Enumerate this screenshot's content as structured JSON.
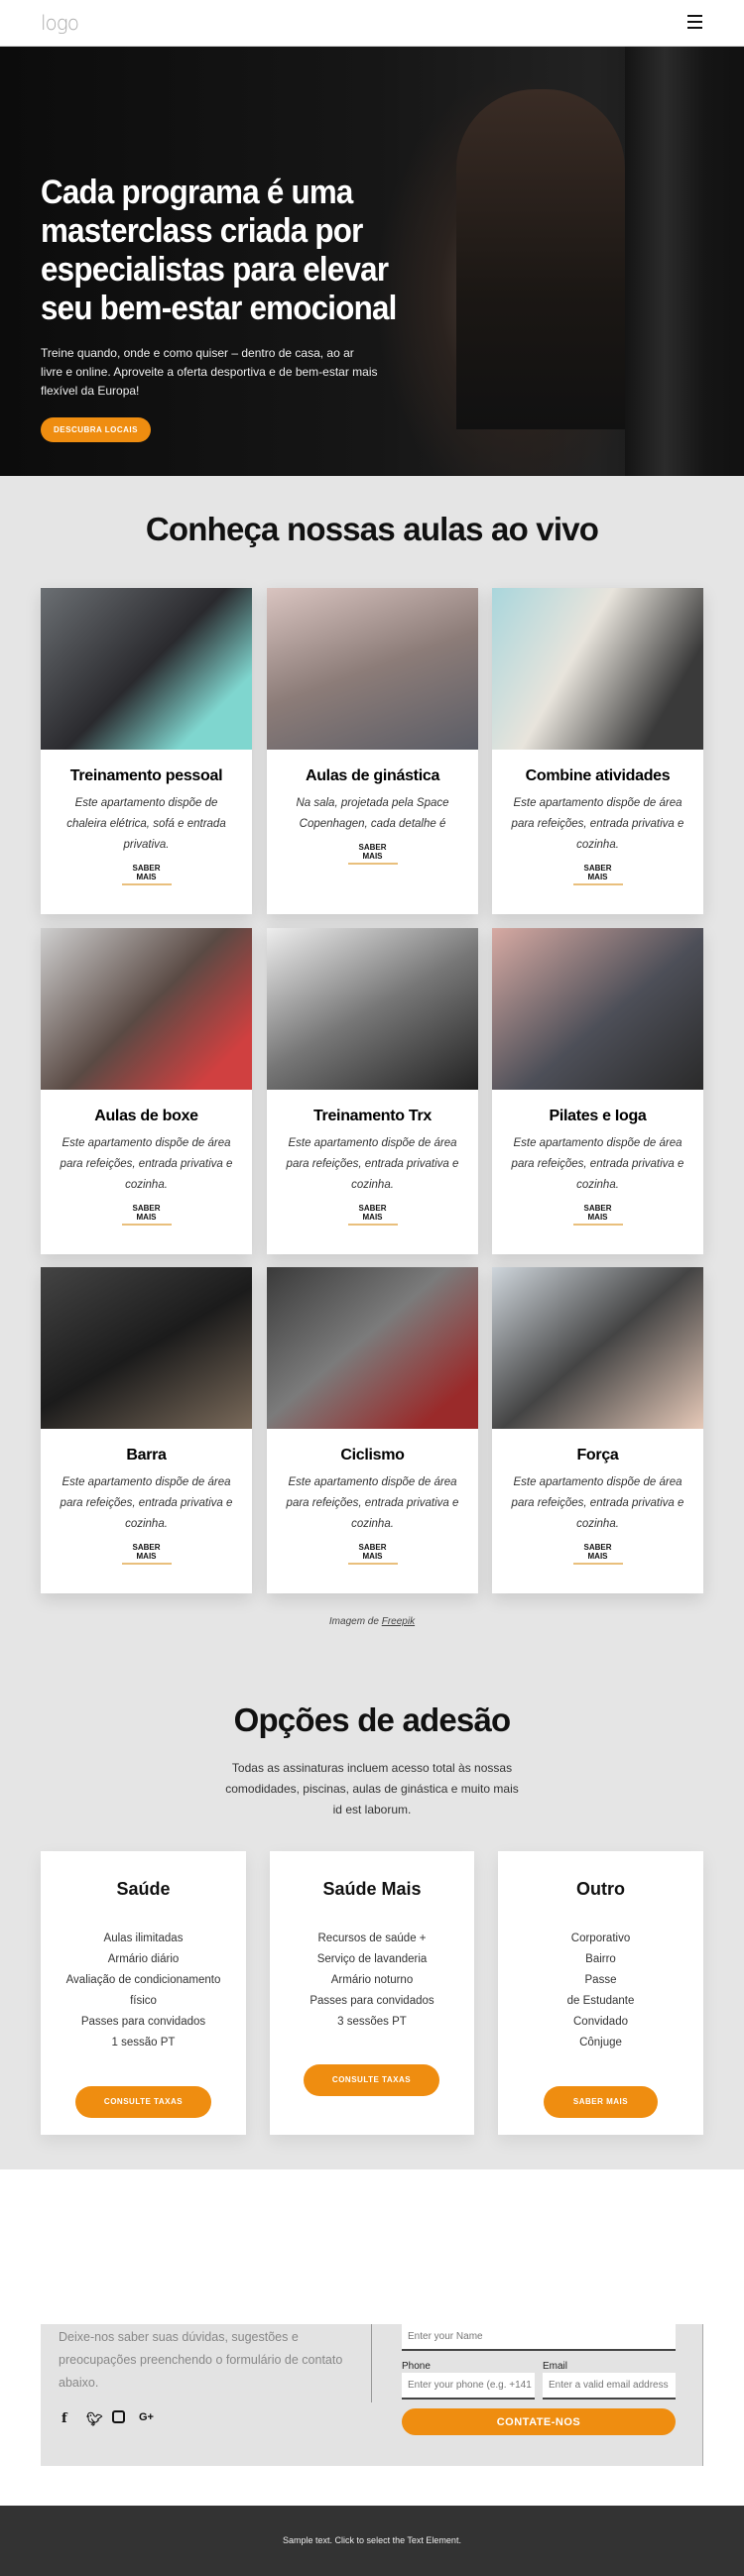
{
  "header": {
    "logo": "logo",
    "menu_icon": "hamburger-icon"
  },
  "hero": {
    "title": "Cada programa é uma masterclass criada por especialistas para elevar seu bem-estar emocional",
    "text": "Treine quando, onde e como quiser – dentro de casa, ao ar livre e online. Aproveite a oferta desportiva e de bem-estar mais flexível da Europa!",
    "button": "DESCUBRA LOCAIS"
  },
  "classes": {
    "title": "Conheça nossas aulas ao vivo",
    "items": [
      {
        "title": "Treinamento pessoal",
        "text": "Este apartamento dispõe de chaleira elétrica, sofá e entrada privativa.",
        "link": "SABER MAIS"
      },
      {
        "title": "Aulas de ginástica",
        "text": "Na sala, projetada pela Space Copenhagen, cada detalhe é",
        "link": "SABER MAIS"
      },
      {
        "title": "Combine atividades",
        "text": "Este apartamento dispõe de área para refeições, entrada privativa e cozinha.",
        "link": "SABER MAIS"
      },
      {
        "title": "Aulas de boxe",
        "text": "Este apartamento dispõe de área para refeições, entrada privativa e cozinha.",
        "link": "SABER MAIS"
      },
      {
        "title": "Treinamento Trx",
        "text": "Este apartamento dispõe de área para refeições, entrada privativa e cozinha.",
        "link": "SABER MAIS"
      },
      {
        "title": "Pilates e Ioga",
        "text": "Este apartamento dispõe de área para refeições, entrada privativa e cozinha.",
        "link": "SABER MAIS"
      },
      {
        "title": "Barra",
        "text": "Este apartamento dispõe de área para refeições, entrada privativa e cozinha.",
        "link": "SABER MAIS"
      },
      {
        "title": "Ciclismo",
        "text": "Este apartamento dispõe de área para refeições, entrada privativa e cozinha.",
        "link": "SABER MAIS"
      },
      {
        "title": "Força",
        "text": "Este apartamento dispõe de área para refeições, entrada privativa e cozinha.",
        "link": "SABER MAIS"
      }
    ],
    "credit_prefix": "Imagem de ",
    "credit_link": "Freepik"
  },
  "membership": {
    "title": "Opções de adesão",
    "subtitle": "Todas as assinaturas incluem acesso total às nossas comodidades, piscinas, aulas de ginástica e muito mais id est laborum.",
    "plans": [
      {
        "name": "Saúde",
        "features": [
          "Aulas ilimitadas",
          "Armário diário",
          "Avaliação de condicionamento",
          "físico",
          "Passes para convidados",
          "1 sessão PT"
        ],
        "button": "CONSULTE TAXAS"
      },
      {
        "name": "Saúde Mais",
        "features": [
          "Recursos de saúde +",
          "Serviço de lavanderia",
          "Armário noturno",
          "Passes para convidados",
          "3 sessões PT"
        ],
        "button": "CONSULTE TAXAS"
      },
      {
        "name": "Outro",
        "features": [
          "Corporativo",
          "Bairro",
          "Passe",
          "de Estudante",
          "Convidado",
          "Cônjuge"
        ],
        "button": "SABER MAIS"
      }
    ]
  },
  "contact": {
    "text": "Deixe-nos saber suas dúvidas, sugestões e preocupações preenchendo o formulário de contato abaixo.",
    "social": [
      "facebook-icon",
      "twitter-icon",
      "instagram-icon",
      "google-plus-icon"
    ],
    "name_placeholder": "Enter your Name",
    "phone_label": "Phone",
    "phone_placeholder": "Enter your phone (e.g. +141",
    "email_label": "Email",
    "email_placeholder": "Enter a valid email address",
    "submit": "CONTATE-NOS"
  },
  "footer": {
    "text": "Sample text. Click to select the Text Element."
  },
  "colors": {
    "accent": "#ef8d10",
    "section_bg": "#e5e5e5",
    "footer_bg": "#333333"
  }
}
